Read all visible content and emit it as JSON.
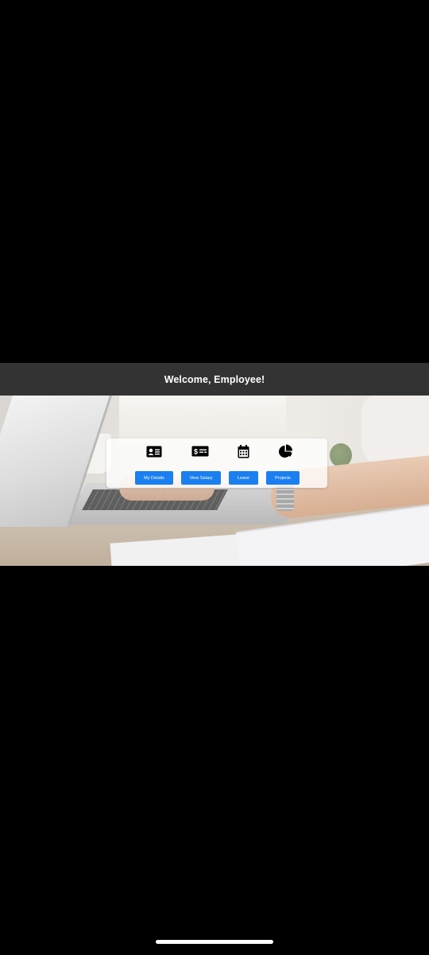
{
  "header": {
    "title": "Welcome, Employee!"
  },
  "hero": {
    "icons": [
      {
        "name": "id-card-icon"
      },
      {
        "name": "money-check-icon"
      },
      {
        "name": "calendar-icon"
      },
      {
        "name": "pie-chart-icon"
      }
    ],
    "buttons": [
      {
        "label": "My Details"
      },
      {
        "label": "View Salary"
      },
      {
        "label": "Leave"
      },
      {
        "label": "Projects"
      }
    ],
    "button_color": "#1a7ff0",
    "icon_color": "#000000"
  },
  "colors": {
    "background": "#000000",
    "header_bg": "#333333",
    "header_text": "#ffffff"
  }
}
